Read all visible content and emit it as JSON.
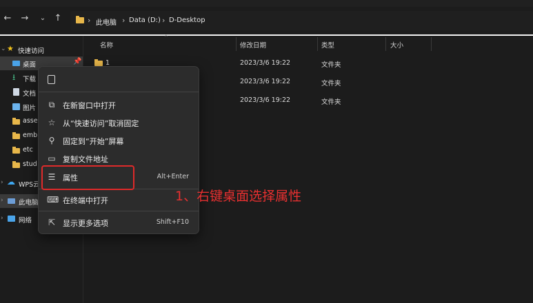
{
  "nav": {
    "back_icon": "arrow-left-icon",
    "forward_icon": "arrow-right-icon",
    "recent_icon": "chevron-down-icon",
    "up_icon": "arrow-up-icon"
  },
  "breadcrumb": {
    "items": [
      "此电脑",
      "Data (D:)",
      "D-Desktop"
    ],
    "separator": "›"
  },
  "sidebar": {
    "items": [
      {
        "label": "快速访问",
        "icon": "star-icon"
      },
      {
        "label": "桌面",
        "icon": "desktop-icon"
      },
      {
        "label": "下载",
        "icon": "download-icon"
      },
      {
        "label": "文档",
        "icon": "document-icon"
      },
      {
        "label": "图片",
        "icon": "picture-icon"
      },
      {
        "label": "asse",
        "icon": "folder-icon"
      },
      {
        "label": "emb",
        "icon": "folder-icon"
      },
      {
        "label": "etc",
        "icon": "folder-icon"
      },
      {
        "label": "stud",
        "icon": "folder-icon"
      },
      {
        "label": "WPS云",
        "icon": "cloud-icon"
      },
      {
        "label": "此电脑",
        "icon": "computer-icon"
      },
      {
        "label": "网络",
        "icon": "network-icon"
      }
    ]
  },
  "columns": {
    "name": "名称",
    "modified": "修改日期",
    "type": "类型",
    "size": "大小"
  },
  "files": [
    {
      "name": "1",
      "modified": "2023/3/6 19:22",
      "type": "文件夹",
      "size": ""
    },
    {
      "name": "",
      "modified": "2023/3/6 19:22",
      "type": "文件夹",
      "size": ""
    },
    {
      "name": "",
      "modified": "2023/3/6 19:22",
      "type": "文件夹",
      "size": ""
    }
  ],
  "context_menu": {
    "top_icon": "copy-icon",
    "items": [
      {
        "label": "在新窗口中打开",
        "shortcut": "",
        "icon": "open-new-window-icon"
      },
      {
        "label": "从“快速访问”取消固定",
        "shortcut": "",
        "icon": "unpin-icon"
      },
      {
        "label": "固定到“开始”屏幕",
        "shortcut": "",
        "icon": "pin-icon"
      },
      {
        "label": "复制文件地址",
        "shortcut": "",
        "icon": "copy-path-icon"
      },
      {
        "label": "属性",
        "shortcut": "Alt+Enter",
        "icon": "properties-icon"
      },
      {
        "label": "在终端中打开",
        "shortcut": "",
        "icon": "terminal-icon"
      },
      {
        "label": "显示更多选项",
        "shortcut": "Shift+F10",
        "icon": "more-options-icon"
      }
    ]
  },
  "annotation": {
    "text": "1、右键桌面选择属性",
    "color": "#e83030"
  }
}
